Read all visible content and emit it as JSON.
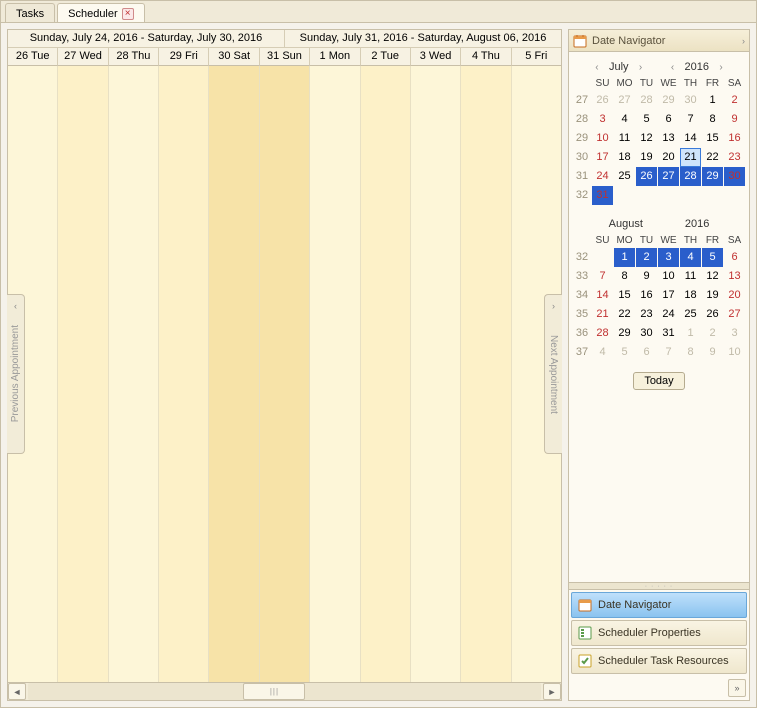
{
  "tabs": {
    "tasks": "Tasks",
    "scheduler": "Scheduler"
  },
  "weeks": {
    "w1": "Sunday, July 24, 2016 - Saturday, July 30, 2016",
    "w2": "Sunday, July 31, 2016 - Saturday, August 06, 2016"
  },
  "days": [
    "26 Tue",
    "27 Wed",
    "28 Thu",
    "29 Fri",
    "30 Sat",
    "31 Sun",
    "1 Mon",
    "2 Tue",
    "3 Wed",
    "4 Thu",
    "5 Fri"
  ],
  "prev_appt": "Previous Appointment",
  "next_appt": "Next Appointment",
  "date_nav_title": "Date Navigator",
  "today_label": "Today",
  "acc": {
    "dn": "Date Navigator",
    "sp": "Scheduler Properties",
    "str": "Scheduler Task Resources"
  },
  "month1": {
    "name": "July",
    "year": "2016",
    "wd": [
      "SU",
      "MO",
      "TU",
      "WE",
      "TH",
      "FR",
      "SA"
    ],
    "rows": [
      {
        "w": "27",
        "d": [
          {
            "v": "26",
            "c": "dim"
          },
          {
            "v": "27",
            "c": "dim"
          },
          {
            "v": "28",
            "c": "dim"
          },
          {
            "v": "29",
            "c": "dim"
          },
          {
            "v": "30",
            "c": "dim"
          },
          {
            "v": "1",
            "c": ""
          },
          {
            "v": "2",
            "c": "red"
          }
        ]
      },
      {
        "w": "28",
        "d": [
          {
            "v": "3",
            "c": "red"
          },
          {
            "v": "4",
            "c": ""
          },
          {
            "v": "5",
            "c": ""
          },
          {
            "v": "6",
            "c": ""
          },
          {
            "v": "7",
            "c": ""
          },
          {
            "v": "8",
            "c": ""
          },
          {
            "v": "9",
            "c": "red"
          }
        ]
      },
      {
        "w": "29",
        "d": [
          {
            "v": "10",
            "c": "red"
          },
          {
            "v": "11",
            "c": ""
          },
          {
            "v": "12",
            "c": ""
          },
          {
            "v": "13",
            "c": ""
          },
          {
            "v": "14",
            "c": ""
          },
          {
            "v": "15",
            "c": ""
          },
          {
            "v": "16",
            "c": "red"
          }
        ]
      },
      {
        "w": "30",
        "d": [
          {
            "v": "17",
            "c": "red"
          },
          {
            "v": "18",
            "c": ""
          },
          {
            "v": "19",
            "c": ""
          },
          {
            "v": "20",
            "c": ""
          },
          {
            "v": "21",
            "c": "today"
          },
          {
            "v": "22",
            "c": ""
          },
          {
            "v": "23",
            "c": "red"
          }
        ]
      },
      {
        "w": "31",
        "d": [
          {
            "v": "24",
            "c": "red"
          },
          {
            "v": "25",
            "c": ""
          },
          {
            "v": "26",
            "c": "sel"
          },
          {
            "v": "27",
            "c": "sel"
          },
          {
            "v": "28",
            "c": "sel"
          },
          {
            "v": "29",
            "c": "sel"
          },
          {
            "v": "30",
            "c": "sel red"
          }
        ]
      },
      {
        "w": "32",
        "d": [
          {
            "v": "31",
            "c": "sel red"
          },
          {
            "v": "",
            "c": ""
          },
          {
            "v": "",
            "c": ""
          },
          {
            "v": "",
            "c": ""
          },
          {
            "v": "",
            "c": ""
          },
          {
            "v": "",
            "c": ""
          },
          {
            "v": "",
            "c": ""
          }
        ]
      }
    ]
  },
  "month2": {
    "name": "August",
    "year": "2016",
    "wd": [
      "SU",
      "MO",
      "TU",
      "WE",
      "TH",
      "FR",
      "SA"
    ],
    "rows": [
      {
        "w": "32",
        "d": [
          {
            "v": "",
            "c": ""
          },
          {
            "v": "1",
            "c": "sel"
          },
          {
            "v": "2",
            "c": "sel"
          },
          {
            "v": "3",
            "c": "sel"
          },
          {
            "v": "4",
            "c": "sel"
          },
          {
            "v": "5",
            "c": "sel"
          },
          {
            "v": "6",
            "c": "red"
          }
        ]
      },
      {
        "w": "33",
        "d": [
          {
            "v": "7",
            "c": "red"
          },
          {
            "v": "8",
            "c": ""
          },
          {
            "v": "9",
            "c": ""
          },
          {
            "v": "10",
            "c": ""
          },
          {
            "v": "11",
            "c": ""
          },
          {
            "v": "12",
            "c": ""
          },
          {
            "v": "13",
            "c": "red"
          }
        ]
      },
      {
        "w": "34",
        "d": [
          {
            "v": "14",
            "c": "red"
          },
          {
            "v": "15",
            "c": ""
          },
          {
            "v": "16",
            "c": ""
          },
          {
            "v": "17",
            "c": ""
          },
          {
            "v": "18",
            "c": ""
          },
          {
            "v": "19",
            "c": ""
          },
          {
            "v": "20",
            "c": "red"
          }
        ]
      },
      {
        "w": "35",
        "d": [
          {
            "v": "21",
            "c": "red"
          },
          {
            "v": "22",
            "c": ""
          },
          {
            "v": "23",
            "c": ""
          },
          {
            "v": "24",
            "c": ""
          },
          {
            "v": "25",
            "c": ""
          },
          {
            "v": "26",
            "c": ""
          },
          {
            "v": "27",
            "c": "red"
          }
        ]
      },
      {
        "w": "36",
        "d": [
          {
            "v": "28",
            "c": "red"
          },
          {
            "v": "29",
            "c": ""
          },
          {
            "v": "30",
            "c": ""
          },
          {
            "v": "31",
            "c": ""
          },
          {
            "v": "1",
            "c": "dim"
          },
          {
            "v": "2",
            "c": "dim"
          },
          {
            "v": "3",
            "c": "dim"
          }
        ]
      },
      {
        "w": "37",
        "d": [
          {
            "v": "4",
            "c": "dim"
          },
          {
            "v": "5",
            "c": "dim"
          },
          {
            "v": "6",
            "c": "dim"
          },
          {
            "v": "7",
            "c": "dim"
          },
          {
            "v": "8",
            "c": "dim"
          },
          {
            "v": "9",
            "c": "dim"
          },
          {
            "v": "10",
            "c": "dim"
          }
        ]
      }
    ]
  }
}
